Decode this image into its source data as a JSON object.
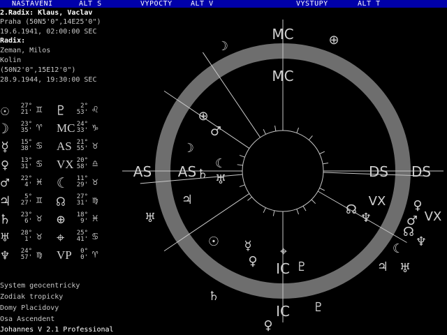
{
  "menu": [
    {
      "label": "NASTAVENI"
    },
    {
      "label": "ALT S"
    },
    {
      "label": "VYPOCTY"
    },
    {
      "label": "ALT V"
    },
    {
      "label": "VYSTUPY"
    },
    {
      "label": "ALT T"
    }
  ],
  "radix2": {
    "title": "2.Radix: Klaus, Vaclav",
    "place": "Praha (50N5'0\",14E25'0\")",
    "date": "19.6.1941, 02:00:00 SEC"
  },
  "radix": {
    "title": "Radix:",
    "name": "Zeman, Milos",
    "place": "Kolin",
    "coords": "(50N2'0\",15E12'0\")",
    "date": "28.9.1944, 19:30:00 SEC"
  },
  "positions": [
    {
      "left": {
        "glyph": "☉",
        "deg": "27°",
        "min": "21'",
        "sign": "♊"
      },
      "right": {
        "glyph": "♇",
        "deg": "2°",
        "min": "53'",
        "sign": "♌"
      }
    },
    {
      "left": {
        "glyph": "☽",
        "deg": "23°",
        "min": "35'",
        "sign": "♈"
      },
      "right": {
        "glyph": "MC",
        "deg": "24°",
        "min": "33'",
        "sign": "♑"
      }
    },
    {
      "left": {
        "glyph": "☿",
        "deg": "15°",
        "min": "38'",
        "sign": "♋"
      },
      "right": {
        "glyph": "AS",
        "deg": "21°",
        "min": "55'",
        "sign": "♉"
      }
    },
    {
      "left": {
        "glyph": "♀",
        "deg": "13°",
        "min": "31'",
        "sign": "♋"
      },
      "right": {
        "glyph": "VX",
        "deg": "20°",
        "min": "58'",
        "sign": "♎"
      }
    },
    {
      "left": {
        "glyph": "♂",
        "deg": "22°",
        "min": "4'",
        "sign": "♓"
      },
      "right": {
        "glyph": "☾",
        "deg": "11°",
        "min": "29'",
        "sign": "♉"
      }
    },
    {
      "left": {
        "glyph": "♃",
        "deg": "5°",
        "min": "27'",
        "sign": "♊"
      },
      "right": {
        "glyph": "☊",
        "deg": "27°",
        "min": "31'",
        "sign": "♍"
      }
    },
    {
      "left": {
        "glyph": "♄",
        "deg": "23°",
        "min": "6'",
        "sign": "♉"
      },
      "right": {
        "glyph": "⊕",
        "deg": "18°",
        "min": "9'",
        "sign": "♓"
      }
    },
    {
      "left": {
        "glyph": "♅",
        "deg": "28°",
        "min": "1'",
        "sign": "♉"
      },
      "right": {
        "glyph": "⌖",
        "deg": "25°",
        "min": "41'",
        "sign": "♋"
      }
    },
    {
      "left": {
        "glyph": "♆",
        "deg": "24°",
        "min": "57'",
        "sign": "♍"
      },
      "right": {
        "glyph": "VP",
        "deg": "0°",
        "min": "0'",
        "sign": "♈"
      }
    }
  ],
  "footer": {
    "system": "System geocentricky",
    "zodiac": "Zodiak tropicky",
    "houses": "Domy Placidovy",
    "axis": "Osa Ascendent",
    "version": "Johannes V 2.1 Professional"
  },
  "chart": {
    "axes": {
      "mc": "MC",
      "ic": "IC",
      "as": "AS",
      "ds": "DS"
    },
    "inner_planets": {
      "sun": "☉",
      "mercury": "☿",
      "venus": "♀",
      "pluto": "♇",
      "neptune": "♆",
      "node": "☊",
      "vertex": "VX",
      "earth": "⊕",
      "mars": "♂",
      "moon": "☽",
      "lilith": "☾",
      "saturn": "♄",
      "uranus": "♅",
      "jupiter": "♃",
      "cross": "⌖"
    },
    "outer_planets": {
      "neptune": "♆",
      "earth": "⊕",
      "moon": "☽",
      "mars": "♂",
      "jupiter": "♃",
      "uranus": "♅",
      "saturn": "♄",
      "pluto": "♇",
      "node": "☊",
      "venus": "♀",
      "mercury": "☿",
      "vertex": "VX",
      "lilith": "☾",
      "sun": "☉",
      "cross": "⌖"
    },
    "colors": {
      "ring": "#6e6e6e",
      "line": "#c8c8c8",
      "menu_bg": "#0000aa"
    }
  }
}
